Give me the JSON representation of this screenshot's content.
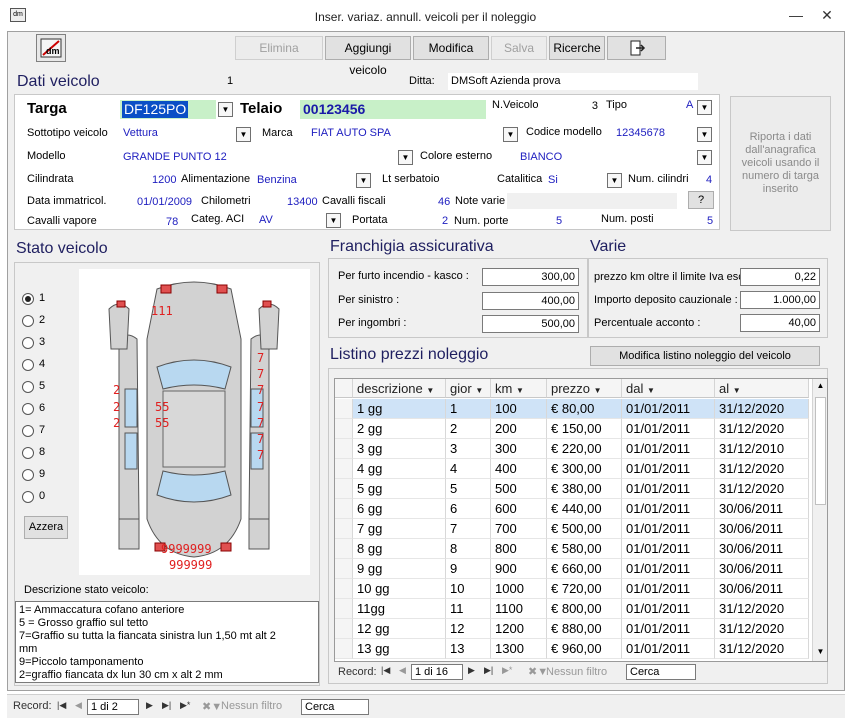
{
  "window": {
    "title": "Inser. variaz. annull. veicoli per il noleggio",
    "app_icon": "dm-icon"
  },
  "toolbar": {
    "elimina": "Elimina",
    "aggiungi": "Aggiungi veicolo",
    "modifica": "Modifica",
    "salva": "Salva",
    "ricerche": "Ricerche"
  },
  "dati": {
    "title": "Dati veicolo",
    "record_num": "1",
    "ditta_label": "Ditta:",
    "ditta_value": "DMSoft Azienda prova",
    "targa_label": "Targa",
    "targa_value": "DF125PO",
    "telaio_label": "Telaio",
    "telaio_value": "00123456",
    "nveicolo_label": "N.Veicolo",
    "nveicolo_value": "3",
    "tipo_label": "Tipo",
    "tipo_value": "A",
    "sottotipo_label": "Sottotipo veicolo",
    "sottotipo_value": "Vettura",
    "marca_label": "Marca",
    "marca_value": "FIAT AUTO SPA",
    "codmod_label": "Codice modello",
    "codmod_value": "12345678",
    "modello_label": "Modello",
    "modello_value": "GRANDE PUNTO 12",
    "colore_label": "Colore esterno",
    "colore_value": "BIANCO",
    "cilindrata_label": "Cilindrata",
    "cilindrata_value": "1200",
    "alimentazione_label": "Alimentazione",
    "alimentazione_value": "Benzina",
    "serbatoio_label": "Lt serbatoio",
    "catalitica_label": "Catalitica",
    "catalitica_value": "Si",
    "numcil_label": "Num. cilindri",
    "numcil_value": "4",
    "dataimm_label": "Data immatricol.",
    "dataimm_value": "01/01/2009",
    "chilometri_label": "Chilometri",
    "chilometri_value": "13400",
    "cavfisc_label": "Cavalli fiscali",
    "cavfisc_value": "46",
    "note_label": "Note varie",
    "note_button": "?",
    "cavvap_label": "Cavalli vapore",
    "cavvap_value": "78",
    "categ_label": "Categ. ACI",
    "categ_value": "AV",
    "portata_label": "Portata",
    "portata_value": "2",
    "numporte_label": "Num. porte",
    "numporte_value": "5",
    "numposti_label": "Num. posti",
    "numposti_value": "5"
  },
  "riporta_button": "Riporta i dati dall'anagrafica veicoli usando il numero di targa inserito",
  "stato": {
    "title": "Stato veicolo",
    "radios": [
      "1",
      "2",
      "3",
      "4",
      "5",
      "6",
      "7",
      "8",
      "9",
      "0"
    ],
    "selected": "1",
    "azzera": "Azzera",
    "damage_marks": [
      "111",
      "2",
      "2",
      "2",
      "55",
      "55",
      "7",
      "7",
      "7",
      "7",
      "7",
      "7",
      "7",
      "9999999",
      "999999"
    ],
    "desc_label": "Descrizione stato veicolo:",
    "desc_lines": [
      "1= Ammaccatura cofano anteriore",
      "5 = Grosso graffio sul tetto",
      "7=Graffio su tutta la fiancata sinistra lun 1,50 mt alt 2",
      "mm",
      "9=Piccolo tamponamento",
      "2=graffio fiancata dx lun 30 cm x alt 2 mm"
    ]
  },
  "franchigia": {
    "title": "Franchigia assicurativa",
    "rows": [
      {
        "label": "Per furto incendio - kasco :",
        "value": "300,00"
      },
      {
        "label": "Per sinistro :",
        "value": "400,00"
      },
      {
        "label": "Per ingombri :",
        "value": "500,00"
      }
    ]
  },
  "varie": {
    "title": "Varie",
    "rows": [
      {
        "label": "prezzo km oltre il limite Iva esc:",
        "value": "0,22"
      },
      {
        "label": "Importo deposito cauzionale :",
        "value": "1.000,00"
      },
      {
        "label": "Percentuale acconto :",
        "value": "40,00"
      }
    ]
  },
  "listino": {
    "title": "Listino prezzi noleggio",
    "modifica_button": "Modifica listino noleggio del veicolo selezionato",
    "columns": [
      "descrizione",
      "gior",
      "km",
      "prezzo",
      "dal",
      "al"
    ],
    "rows": [
      [
        "1 gg",
        "1",
        "100",
        "€ 80,00",
        "01/01/2011",
        "31/12/2020"
      ],
      [
        "2 gg",
        "2",
        "200",
        "€ 150,00",
        "01/01/2011",
        "31/12/2020"
      ],
      [
        "3 gg",
        "3",
        "300",
        "€ 220,00",
        "01/01/2011",
        "31/12/2010"
      ],
      [
        "4 gg",
        "4",
        "400",
        "€ 300,00",
        "01/01/2011",
        "31/12/2020"
      ],
      [
        "5 gg",
        "5",
        "500",
        "€ 380,00",
        "01/01/2011",
        "31/12/2020"
      ],
      [
        "6 gg",
        "6",
        "600",
        "€ 440,00",
        "01/01/2011",
        "30/06/2011"
      ],
      [
        "7 gg",
        "7",
        "700",
        "€ 500,00",
        "01/01/2011",
        "30/06/2011"
      ],
      [
        "8 gg",
        "8",
        "800",
        "€ 580,00",
        "01/01/2011",
        "30/06/2011"
      ],
      [
        "9 gg",
        "9",
        "900",
        "€ 660,00",
        "01/01/2011",
        "30/06/2011"
      ],
      [
        "10 gg",
        "10",
        "1000",
        "€ 720,00",
        "01/01/2011",
        "30/06/2011"
      ],
      [
        "11gg",
        "11",
        "1100",
        "€ 800,00",
        "01/01/2011",
        "31/12/2020"
      ],
      [
        "12 gg",
        "12",
        "1200",
        "€ 880,00",
        "01/01/2011",
        "31/12/2020"
      ],
      [
        "13 gg",
        "13",
        "1300",
        "€ 960,00",
        "01/01/2011",
        "31/12/2020"
      ]
    ],
    "nav_record_label": "Record:",
    "nav_pos": "1 di 16",
    "nav_filter": "Nessun filtro",
    "nav_search": "Cerca"
  },
  "bottom_nav": {
    "record_label": "Record:",
    "pos": "1 di 2",
    "filter": "Nessun filtro",
    "search": "Cerca"
  }
}
